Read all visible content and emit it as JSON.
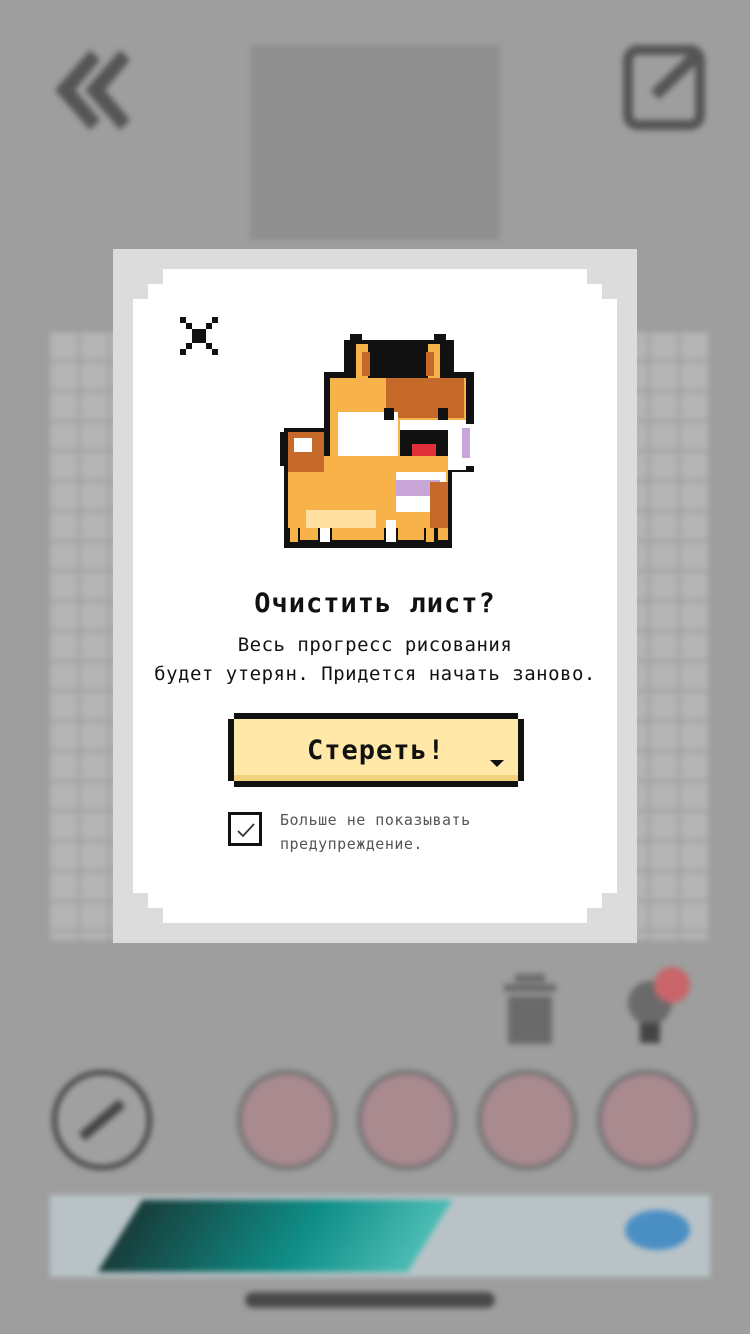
{
  "background": {
    "icons": {
      "back": "double-chevron-left-icon",
      "edit": "pencil-edit-icon",
      "trash": "trash-icon",
      "hint": "lightbulb-icon",
      "brush": "brush-icon"
    },
    "swatch_colors": [
      "#a88a8f",
      "#a88a8f",
      "#a88a8f",
      "#a88a8f"
    ],
    "hint_badge_color": "#c9656a"
  },
  "dialog": {
    "close_icon": "close-icon",
    "illustration": "shiba-dog-pixel-art",
    "title": "Очистить лист?",
    "message_line1": "Весь прогресс рисования",
    "message_line2": "будет утерян. Придется начать заново.",
    "confirm_label": "Стереть!",
    "dont_show": {
      "checked": true,
      "line1": "Больше не показывать",
      "line2": "предупреждение."
    },
    "colors": {
      "button_fill": "#ffe8a8",
      "dog_orange": "#f7b24a",
      "dog_brown": "#c56a2a",
      "tongue": "#e0303a"
    }
  }
}
